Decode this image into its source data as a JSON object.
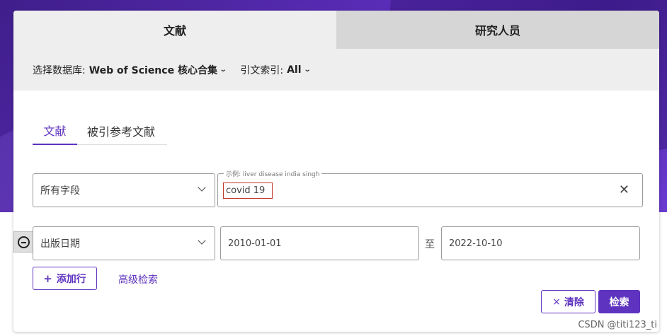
{
  "top_tabs": {
    "documents": "文献",
    "researchers": "研究人员"
  },
  "database_bar": {
    "db_label": "选择数据库:",
    "db_value": "Web of Science 核心合集",
    "cite_label": "引文索引:",
    "cite_value": "All"
  },
  "sub_tabs": {
    "documents": "文献",
    "cited_refs": "被引参考文献"
  },
  "row1": {
    "field": "所有字段",
    "example_legend": "示例: liver disease india singh",
    "query": "covid 19"
  },
  "row2": {
    "field": "出版日期",
    "start_date": "2010-01-01",
    "to_label": "至",
    "end_date": "2022-10-10"
  },
  "actions": {
    "add_row": "添加行",
    "add_row_plus": "+",
    "advanced": "高级检索",
    "clear": "清除",
    "clear_x": "×",
    "search": "检索"
  },
  "watermark": "CSDN @titi123_ti",
  "colors": {
    "accent": "#5e33bf",
    "header_bg": "#eeeeee",
    "inactive_tab": "#d6d6d6"
  }
}
